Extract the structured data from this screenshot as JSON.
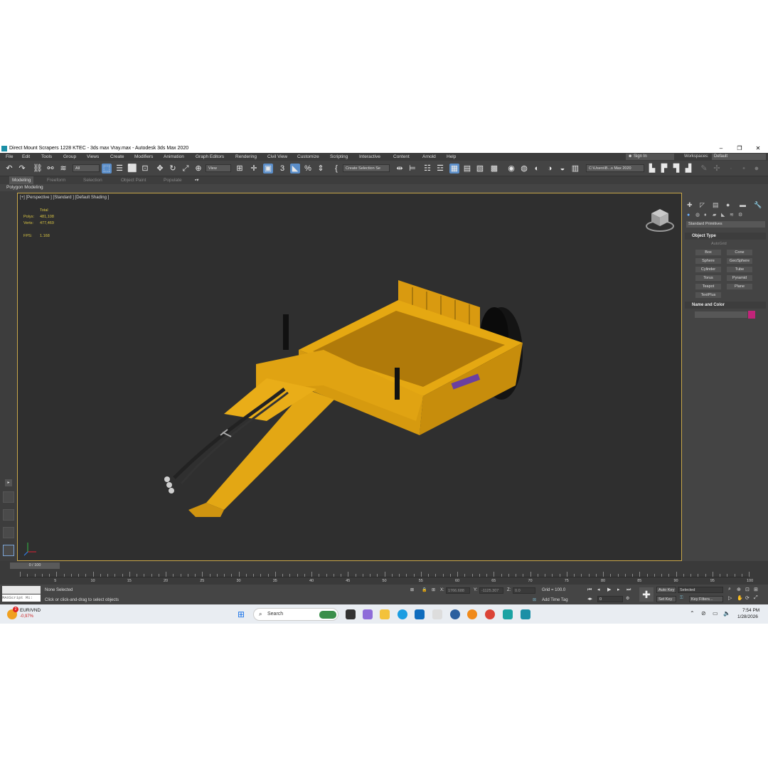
{
  "window": {
    "title": "Direct Mount Scrapers 1228 KTEC - 3ds max Vray.max - Autodesk 3ds Max 2020",
    "minimize": "–",
    "restore": "❐",
    "close": "✕"
  },
  "menu": [
    "File",
    "Edit",
    "Tools",
    "Group",
    "Views",
    "Create",
    "Modifiers",
    "Animation",
    "Graph Editors",
    "Rendering",
    "Civil View",
    "Customize",
    "Scripting",
    "Interactive",
    "Content",
    "Arnold",
    "Help"
  ],
  "signin": "Sign In",
  "workspaces_label": "Workspaces:",
  "workspaces_value": "Default",
  "toolbar": {
    "filter_all": "All",
    "view": "View",
    "create_selection_set": "Create Selection Se",
    "path": "C:\\Users\\B...s Max 2020"
  },
  "ribbon": {
    "tabs": [
      "Modeling",
      "Freeform",
      "Selection",
      "Object Paint",
      "Populate"
    ],
    "polygon_modeling": "Polygon Modeling"
  },
  "viewport": {
    "label": "[+] [Perspective ] [Standard ] [Default Shading ]",
    "stats": {
      "total_label": "Total",
      "polys_label": "Polys:",
      "polys_value": "481,108",
      "verts_label": "Verts:",
      "verts_value": "477,469",
      "fps_label": "FPS:",
      "fps_value": "1.168"
    }
  },
  "command_panel": {
    "dropdown": "Standard Primitives",
    "object_type": "Object Type",
    "autogrid": "AutoGrid",
    "primitives": [
      "Box",
      "Cone",
      "Sphere",
      "GeoSphere",
      "Cylinder",
      "Tube",
      "Torus",
      "Pyramid",
      "Teapot",
      "Plane",
      "TextPlus"
    ],
    "name_and_color": "Name and Color",
    "color": "#c2247a"
  },
  "timeline": {
    "frame": "0 / 100",
    "ticks": [
      "5",
      "10",
      "15",
      "20",
      "25",
      "30",
      "35",
      "40",
      "45",
      "50",
      "55",
      "60",
      "65",
      "70",
      "75",
      "80",
      "85",
      "90",
      "95",
      "100"
    ]
  },
  "status": {
    "maxscript": "MAXScript Mi:",
    "selection": "None Selected",
    "prompt": "Click or click-and-drag to select objects",
    "x_label": "X:",
    "x_value": "1766.688",
    "y_label": "Y:",
    "y_value": "-1125.307",
    "z_label": "Z:",
    "z_value": "0.0",
    "grid": "Grid = 100.0",
    "add_time_tag": "Add Time Tag",
    "auto_key": "Auto Key",
    "selected": "Selected",
    "set_key": "Set Key",
    "key_filters": "Key Filters...",
    "frame_field": "0"
  },
  "taskbar": {
    "ticker_label": "EUR/VND",
    "ticker_value": "-0,97%",
    "badge": "2",
    "search": "Search",
    "time": "7:54 PM",
    "date": "1/28/2026"
  }
}
